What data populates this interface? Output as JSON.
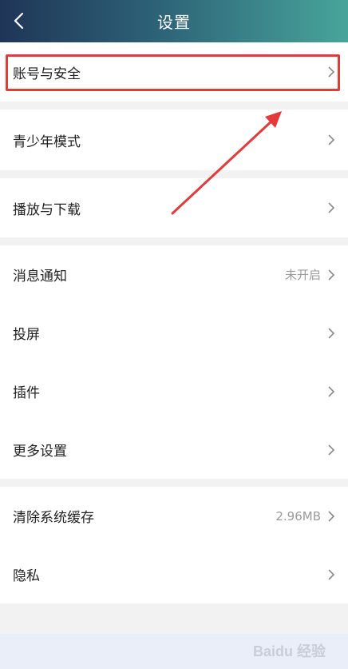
{
  "header": {
    "title": "设置",
    "back_icon": "chevron-left-icon"
  },
  "sections": [
    {
      "items": [
        {
          "label": "账号与安全",
          "value": ""
        }
      ]
    },
    {
      "items": [
        {
          "label": "青少年模式",
          "value": ""
        }
      ]
    },
    {
      "items": [
        {
          "label": "播放与下载",
          "value": ""
        }
      ]
    },
    {
      "items": [
        {
          "label": "消息通知",
          "value": "未开启"
        },
        {
          "label": "投屏",
          "value": ""
        },
        {
          "label": "插件",
          "value": ""
        },
        {
          "label": "更多设置",
          "value": ""
        }
      ]
    },
    {
      "items": [
        {
          "label": "清除系统缓存",
          "value": "2.96MB"
        },
        {
          "label": "隐私",
          "value": ""
        }
      ]
    }
  ],
  "annotation": {
    "highlight_color": "#e43a3a",
    "arrow_color": "#e43a3a"
  },
  "watermark": {
    "text": "Baidu 经验"
  }
}
